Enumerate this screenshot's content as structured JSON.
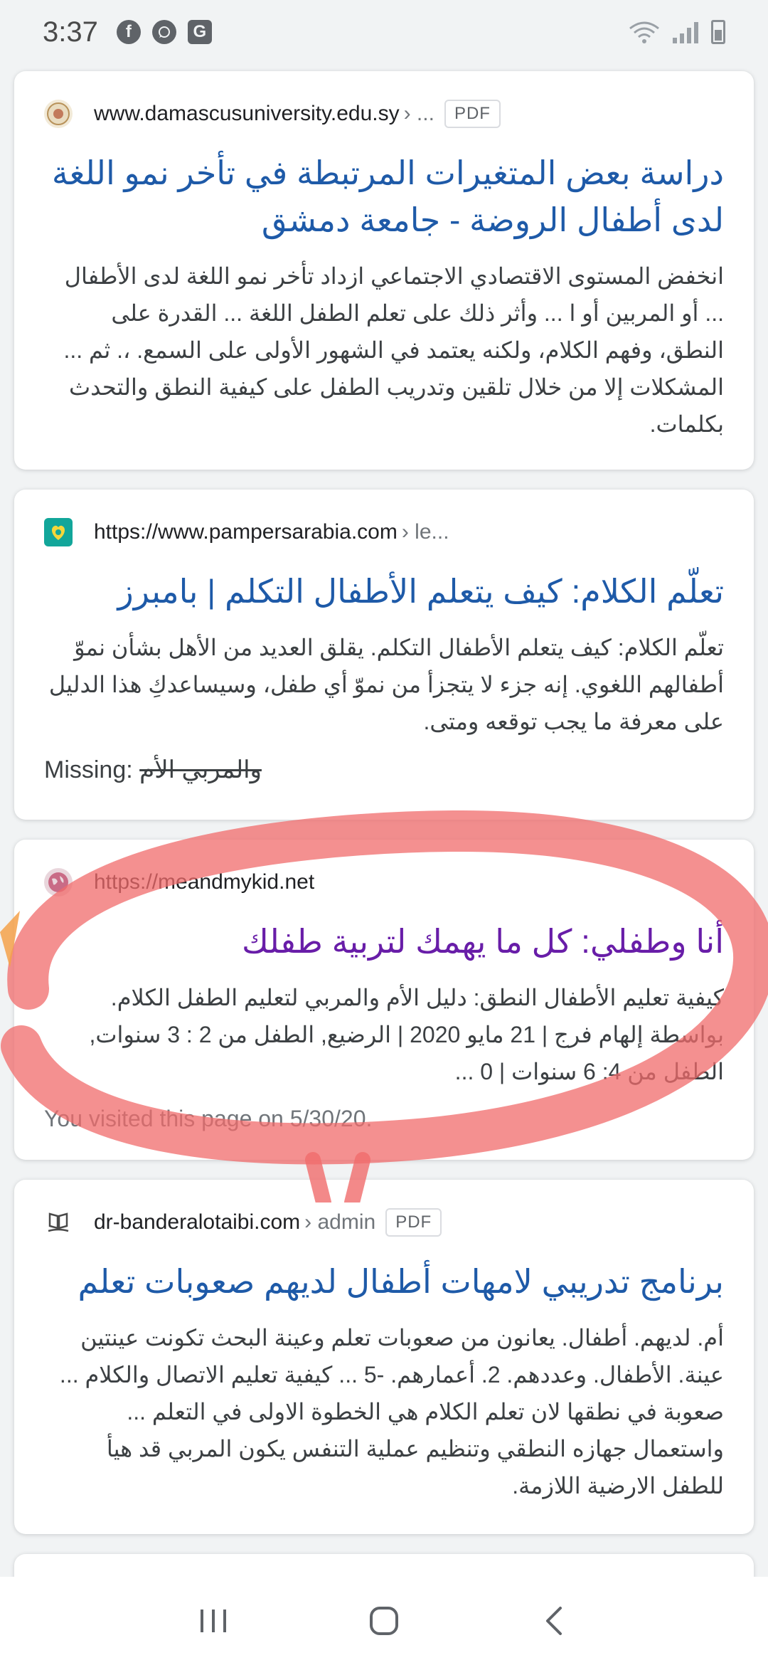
{
  "status_bar": {
    "time": "3:37",
    "notification_icons": [
      "facebook-icon",
      "whatsapp-icon",
      "translate-icon"
    ],
    "system_icons": [
      "wifi-icon",
      "signal-icon",
      "battery-icon"
    ]
  },
  "results": [
    {
      "url": "www.damascusuniversity.edu.sy",
      "crumb": "› ...",
      "badge": "PDF",
      "title": "دراسة بعض المتغيرات المرتبطة في تأخر نمو اللغة لدى أطفال الروضة - جامعة دمشق",
      "snippet": "انخفض المستوى الاقتصادي الاجتماعي ازداد تأخر نمو اللغة لدى الأطفال ... أو المربين أو ا ... وأثر ذلك على تعلم الطفل اللغة ... القدرة على النطق، وفهم الكلام، ولكنه يعتمد في الشهور الأولى على السمع. ،. ثم ... المشكلات إلا من خلال تلقين وتدريب الطفل على كيفية النطق والتحدث بكلمات."
    },
    {
      "url": "https://www.pampersarabia.com",
      "crumb": "› le...",
      "title": "تعلّم الكلام: كيف يتعلم الأطفال التكلم | بامبرز",
      "snippet": "تعلّم الكلام: كيف يتعلم الأطفال التكلم. يقلق العديد من الأهل بشأن نموّ أطفالهم اللغوي. إنه جزء لا يتجزأ من نموّ أي طفل، وسيساعدكِ هذا الدليل على معرفة ما يجب توقعه ومتى.",
      "missing_label": "Missing:",
      "missing_terms": "والمربي الأم"
    },
    {
      "url": "https://meandmykid.net",
      "title": "أنا وطفلي: كل ما يهمك لتربية طفلك",
      "snippet": "كيفية تعليم الأطفال النطق: دليل الأم والمربي لتعليم الطفل الكلام. بواسطة إلهام فرج | 21 مايو 2020 | الرضيع, الطفل من 2 : 3 سنوات, الطفل من 4: 6 سنوات | 0 ...",
      "visited_note": "You visited this page on 5/30/20."
    },
    {
      "url": "dr-banderalotaibi.com",
      "crumb": "› admin",
      "badge": "PDF",
      "title": "برنامج تدريبي لامهات أطفال لديهم صعوبات تعلم",
      "snippet": "أم. لديهم. أطفال. يعانون من صعوبات تعلم وعينة البحث تكونت عينتين عينة. الأطفال. وعددهم. 2. أعمارهم. -5 ... كيفية تعليم الاتصال والكلام ... صعوبة في نطقها لان تعلم الكلام هي الخطوة الاولى في التعلم ... واستعمال جهازه النطقي وتنظيم عملية التنفس يكون المربي قد هيأ للطفل الارضية اللازمة."
    }
  ],
  "colors": {
    "title_link": "#1e5aa8",
    "visited_link": "#681da8",
    "annotation": "#f06b6b"
  },
  "nav_bar": {
    "buttons": [
      "recent-apps-icon",
      "home-icon",
      "back-icon"
    ]
  }
}
